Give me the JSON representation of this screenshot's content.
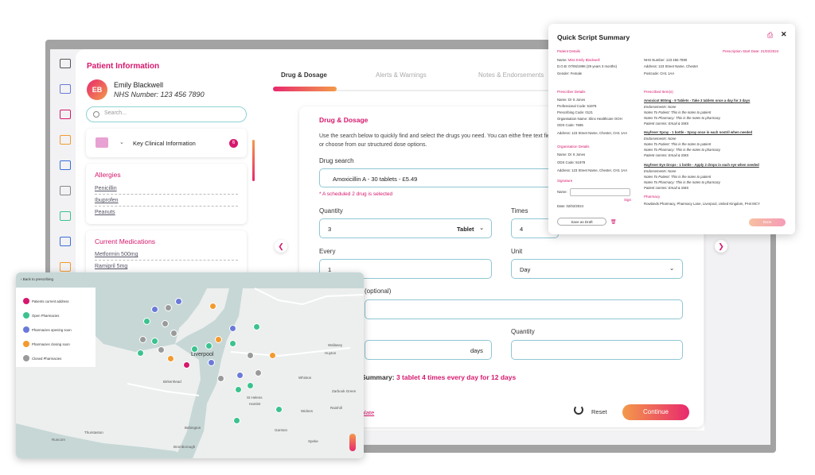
{
  "patient_panel": {
    "title": "Patient Information",
    "avatar_initials": "EB",
    "name": "Emily Blackwell",
    "nhs": "NHS Number: 123 456 7890",
    "search_placeholder": "Search...",
    "key_clinical": {
      "label": "Key Clinical Information",
      "count": "6"
    },
    "allergies": {
      "title": "Allergies",
      "items": [
        "Penicillin",
        "Ibuprofen",
        "Peanuts"
      ]
    },
    "medications": {
      "title": "Current Medications",
      "items": [
        "Metformin 500mg",
        "Ramipril 5mg"
      ]
    }
  },
  "tabs": [
    "Drug & Dosage",
    "Alerts & Warnings",
    "Notes & Endorsements"
  ],
  "form": {
    "title": "Drug & Dosage",
    "description": "Use the search below to quickly find and select the drugs you need. You can eithe free text field or choose from our structured dose options.",
    "drug_search_label": "Drug search",
    "drug_search_value": "Amoxicillin A - 30 tablets - £5.49",
    "warning": "* A scheduled 2 drug is selected",
    "quantity_label": "Quantity",
    "quantity_value": "3",
    "quantity_unit": "Tablet",
    "times_label": "Times",
    "times_value": "4",
    "every_label": "Every",
    "every_value": "1",
    "unit_label": "Unit",
    "unit_value": "Day",
    "optional_label": "(optional)",
    "days_unit": "days",
    "quantity2_label": "Quantity",
    "summary_prefix": "Summary:",
    "summary_value": "3 tablet 4 times every day for 12 days",
    "template_link": "plate",
    "reset_label": "Reset",
    "continue_label": "Continue"
  },
  "quick_script": {
    "title": "Quick Script Summary",
    "patient_details_h": "Patient Details",
    "start_date": "Prescription Start Date: 21/02/2024",
    "name_label": "Name:",
    "name_value": "Miss Emily Blackwell",
    "dob": "D.O.B: 07/06/1996 (29 years 3 months)",
    "gender": "Gender: Female",
    "nhs": "NHS Number: 123 456 7890",
    "address": "Address: 123 Street Name, Chester",
    "postcode": "Postcode: CH1 1AA",
    "prescriber_h": "Prescriber Details",
    "prescriber_lines": [
      "Name: Dr S Jones",
      "Professional Code: 51978",
      "Prescribing Code: 0121",
      "Organisation Name: Slinx Healthcare OOH",
      "ODS Code: 7685",
      "Address: 123 Street Name, Chester, CH1 1AA"
    ],
    "org_h": "Organisation Details",
    "org_lines": [
      "Name: Dr S Jones",
      "ODS Code: 51978",
      "Address: 123 Street Name, Chester, CH1 1AA"
    ],
    "signature_h": "Signature",
    "sig_name": "Name:",
    "sign": "Sign",
    "date": "Date: 02/02/2024",
    "items_h": "Prescribed Item(s)",
    "items": [
      {
        "title": "Amoxicot 500mg - 9 Tablets - Take 3 tablets once a day for 3 days",
        "lines": [
          "Endorsements: None",
          "Notes To Patient: This is the notes to patient",
          "Notes To Pharmacy: This is the notes to pharmacy",
          "Patient comms: Email & SMS"
        ]
      },
      {
        "title": "Hayfever Spray - 1 bottle - Spray once in each nostril when needed",
        "lines": [
          "Endorsements: None",
          "Notes To Patient: This is the notes to patient",
          "Notes To Pharmacy: This is the notes to pharmacy",
          "Patient comms: Email & SMS"
        ]
      },
      {
        "title": "Hayfever Eye Drops - 1 bottle - Apply 2 drops in each eye when needed",
        "lines": [
          "Endorsements: None",
          "Notes To Patient: This is the notes to patient",
          "Notes To Pharmacy: This is the notes to pharmacy",
          "Patient comms: Email & SMS"
        ]
      }
    ],
    "pharmacy_h": "Pharmacy",
    "pharmacy": "Rowlands Pharmacy, Pharmacy Lane, Liverpool, United Kingdom, PH4 MCY",
    "save_draft": "Save as Draft",
    "done": "Done"
  },
  "map": {
    "back": "Back to prescribing",
    "legend": [
      {
        "label": "Patients current address",
        "color": "#d6186d"
      },
      {
        "label": "Open Pharmacies",
        "color": "#3cc28f"
      },
      {
        "label": "Pharmacies opening soon",
        "color": "#6b79d9"
      },
      {
        "label": "Pharmacies closing soon",
        "color": "#f39a2e"
      },
      {
        "label": "Closed Pharmacies",
        "color": "#9a9a9a"
      }
    ],
    "places": [
      "Liverpool",
      "Birkenhead",
      "Hoylake",
      "Wallasey",
      "Huyton",
      "Widnes",
      "Runcorn",
      "Speke",
      "Garston",
      "Bebington",
      "Thurstaston",
      "Bromborough",
      "Zarbook Green",
      "St Helens",
      "Whiston",
      "Rainhill",
      "Hamlet",
      "Garston"
    ]
  }
}
